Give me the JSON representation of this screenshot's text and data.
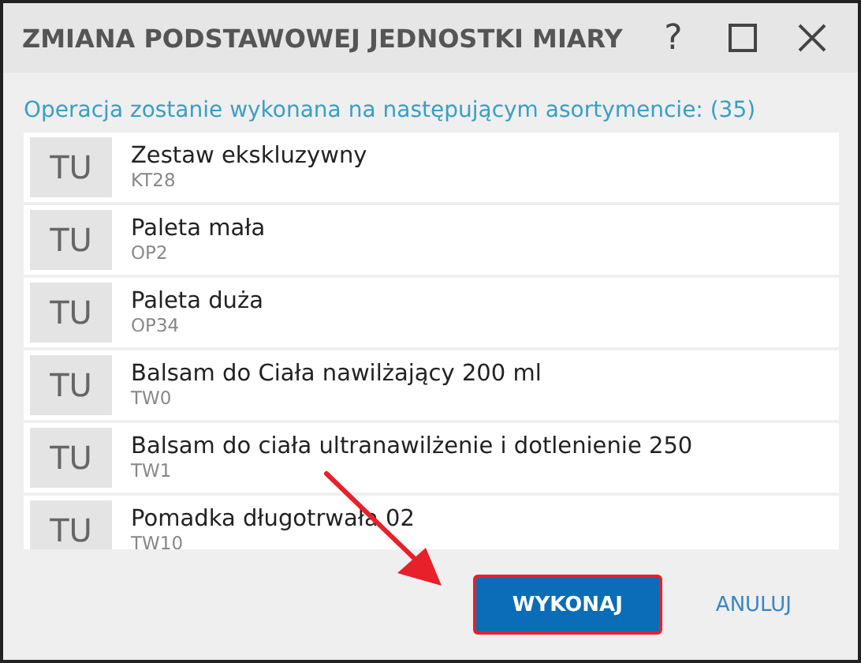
{
  "window": {
    "title": "ZMIANA PODSTAWOWEJ JEDNOSTKI MIARY"
  },
  "title_buttons": [
    {
      "kind": "help",
      "label": "?"
    },
    {
      "kind": "maximize"
    },
    {
      "kind": "close"
    }
  ],
  "info": "Operacja zostanie wykonana na następującym asortymencie: (35)",
  "items": [
    {
      "unit": "TU",
      "name": "Zestaw ekskluzywny",
      "code": "KT28"
    },
    {
      "unit": "TU",
      "name": "Paleta mała",
      "code": "OP2"
    },
    {
      "unit": "TU",
      "name": "Paleta duża",
      "code": "OP34"
    },
    {
      "unit": "TU",
      "name": "Balsam do Ciała nawilżający 200 ml",
      "code": "TW0"
    },
    {
      "unit": "TU",
      "name": "Balsam do ciała ultranawilżenie i dotlenienie 250",
      "code": "TW1"
    },
    {
      "unit": "TU",
      "name": "Pomadka długotrwała 02",
      "code": "TW10"
    }
  ],
  "buttons": [
    {
      "kind": "primary",
      "label": "WYKONAJ",
      "highlighted": true
    },
    {
      "kind": "link",
      "label": "ANULUJ",
      "highlighted": false
    }
  ]
}
